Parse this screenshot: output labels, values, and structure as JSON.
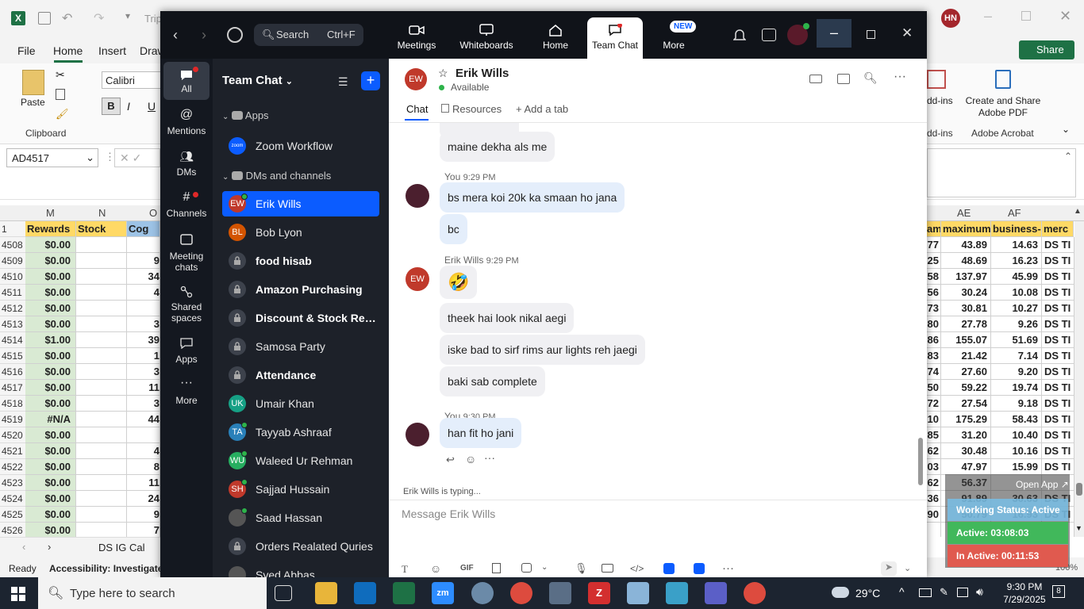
{
  "excel": {
    "title_fragment": "Trip",
    "menu": [
      "File",
      "Home",
      "Insert",
      "Draw"
    ],
    "share_label": "Share",
    "clipboard": {
      "paste_label": "Paste",
      "group_label": "Clipboard"
    },
    "font_name": "Calibri",
    "addins_label": "dd-ins",
    "addins_group": "dd-ins",
    "adobe": {
      "button": "Create and Share Adobe PDF",
      "group": "Adobe Acrobat"
    },
    "name_box": "AD4517",
    "columns_left": [
      "M",
      "N",
      "O"
    ],
    "columns_right": [
      "AE",
      "AF"
    ],
    "header_row_num": "1",
    "header_left": [
      "Rewards",
      "Stock",
      "Cog"
    ],
    "header_right": [
      "am",
      "maximum",
      "business-(",
      "merc"
    ],
    "rows": [
      {
        "n": "4508",
        "rewards": "$0.00",
        "o": "",
        "ad": "77",
        "ae": "43.89",
        "af": "14.63",
        "ag": "DS TI"
      },
      {
        "n": "4509",
        "rewards": "$0.00",
        "o": "9",
        "ad": "25",
        "ae": "48.69",
        "af": "16.23",
        "ag": "DS TI"
      },
      {
        "n": "4510",
        "rewards": "$0.00",
        "o": "34",
        "ad": "58",
        "ae": "137.97",
        "af": "45.99",
        "ag": "DS TI"
      },
      {
        "n": "4511",
        "rewards": "$0.00",
        "o": "4",
        "ad": "56",
        "ae": "30.24",
        "af": "10.08",
        "ag": "DS TI"
      },
      {
        "n": "4512",
        "rewards": "$0.00",
        "o": "",
        "ad": "73",
        "ae": "30.81",
        "af": "10.27",
        "ag": "DS TI"
      },
      {
        "n": "4513",
        "rewards": "$0.00",
        "o": "3",
        "ad": "80",
        "ae": "27.78",
        "af": "9.26",
        "ag": "DS TI"
      },
      {
        "n": "4514",
        "rewards": "$1.00",
        "o": "39",
        "ad": "86",
        "ae": "155.07",
        "af": "51.69",
        "ag": "DS TI"
      },
      {
        "n": "4515",
        "rewards": "$0.00",
        "o": "1",
        "ad": "83",
        "ae": "21.42",
        "af": "7.14",
        "ag": "DS TI"
      },
      {
        "n": "4516",
        "rewards": "$0.00",
        "o": "3",
        "ad": "74",
        "ae": "27.60",
        "af": "9.20",
        "ag": "DS TI"
      },
      {
        "n": "4517",
        "rewards": "$0.00",
        "o": "11",
        "ad": "50",
        "ae": "59.22",
        "af": "19.74",
        "ag": "DS TI"
      },
      {
        "n": "4518",
        "rewards": "$0.00",
        "o": "3",
        "ad": "72",
        "ae": "27.54",
        "af": "9.18",
        "ag": "DS TI"
      },
      {
        "n": "4519",
        "rewards": "#N/A",
        "o": "44",
        "ad": "10",
        "ae": "175.29",
        "af": "58.43",
        "ag": "DS TI"
      },
      {
        "n": "4520",
        "rewards": "$0.00",
        "o": "",
        "ad": "85",
        "ae": "31.20",
        "af": "10.40",
        "ag": "DS TI"
      },
      {
        "n": "4521",
        "rewards": "$0.00",
        "o": "4",
        "ad": "62",
        "ae": "30.48",
        "af": "10.16",
        "ag": "DS TI"
      },
      {
        "n": "4522",
        "rewards": "$0.00",
        "o": "8",
        "ad": "03",
        "ae": "47.97",
        "af": "15.99",
        "ag": "DS TI"
      },
      {
        "n": "4523",
        "rewards": "$0.00",
        "o": "11",
        "ad": "62",
        "ae": "56.37",
        "af": "",
        "ag": ""
      },
      {
        "n": "4524",
        "rewards": "$0.00",
        "o": "24",
        "ad": "36",
        "ae": "91.89",
        "af": "30.63",
        "ag": "DS TI"
      },
      {
        "n": "4525",
        "rewards": "$0.00",
        "o": "9",
        "ad": "90",
        "ae": "50.79",
        "af": "16.93",
        "ag": "DS TI"
      },
      {
        "n": "4526",
        "rewards": "$0.00",
        "o": "7",
        "ad": "",
        "ae": "",
        "af": "",
        "ag": ""
      }
    ],
    "sheet_tab": "DS IG Cal",
    "status_ready": "Ready",
    "status_accessibility": "Accessibility: Investigate",
    "zoom_pct": "100%"
  },
  "zoom": {
    "search_label": "Search",
    "search_shortcut": "Ctrl+F",
    "nav": [
      {
        "label": "Meetings"
      },
      {
        "label": "Whiteboards"
      },
      {
        "label": "Home"
      },
      {
        "label": "Team Chat"
      },
      {
        "label": "More"
      }
    ],
    "new_badge": "NEW",
    "rail": [
      "All",
      "Mentions",
      "DMs",
      "Channels",
      "Meeting chats",
      "Shared spaces",
      "Apps",
      "More"
    ],
    "list_title": "Team Chat",
    "sections": {
      "apps": "Apps",
      "dms": "DMs and channels"
    },
    "app_item": {
      "name": "Zoom Workflow",
      "icon_text": "zoom"
    },
    "channels": [
      {
        "name": "Erik Wills",
        "initials": "EW",
        "color": "#c0392b",
        "bold": false,
        "selected": true,
        "online": true,
        "type": "dm"
      },
      {
        "name": "Bob Lyon",
        "initials": "BL",
        "color": "#d35400",
        "bold": false,
        "selected": false,
        "online": false,
        "type": "dm"
      },
      {
        "name": "food hisab",
        "initials": "",
        "color": "",
        "bold": true,
        "selected": false,
        "online": false,
        "type": "lock"
      },
      {
        "name": "Amazon Purchasing",
        "initials": "",
        "color": "",
        "bold": true,
        "selected": false,
        "online": false,
        "type": "lock"
      },
      {
        "name": "Discount & Stock Res...",
        "initials": "",
        "color": "",
        "bold": true,
        "selected": false,
        "online": false,
        "type": "lock"
      },
      {
        "name": "Samosa Party",
        "initials": "",
        "color": "",
        "bold": false,
        "selected": false,
        "online": false,
        "type": "lock"
      },
      {
        "name": "Attendance",
        "initials": "",
        "color": "",
        "bold": true,
        "selected": false,
        "online": false,
        "type": "lock"
      },
      {
        "name": "Umair Khan",
        "initials": "UK",
        "color": "#16a085",
        "bold": false,
        "selected": false,
        "online": false,
        "type": "dm"
      },
      {
        "name": "Tayyab Ashraaf",
        "initials": "TA",
        "color": "#2980b9",
        "bold": false,
        "selected": false,
        "online": true,
        "type": "dm"
      },
      {
        "name": "Waleed Ur Rehman",
        "initials": "WU",
        "color": "#27ae60",
        "bold": false,
        "selected": false,
        "online": true,
        "type": "dm"
      },
      {
        "name": "Sajjad Hussain",
        "initials": "SH",
        "color": "#c0392b",
        "bold": false,
        "selected": false,
        "online": true,
        "type": "dm"
      },
      {
        "name": "Saad Hassan",
        "initials": "",
        "color": "#555",
        "bold": false,
        "selected": false,
        "online": true,
        "type": "photo"
      },
      {
        "name": "Orders Realated Quries",
        "initials": "",
        "color": "",
        "bold": false,
        "selected": false,
        "online": false,
        "type": "lock"
      },
      {
        "name": "Syed Abbas",
        "initials": "",
        "color": "#555",
        "bold": false,
        "selected": false,
        "online": false,
        "type": "photo"
      }
    ],
    "chat": {
      "contact_initials": "EW",
      "contact_name": "Erik Wills",
      "contact_status": "Available",
      "tabs": [
        "Chat",
        "Resources",
        "Add a tab"
      ],
      "messages": [
        {
          "text": "maine dekha als me",
          "mine": false
        },
        {
          "sender": "You",
          "time": "9:29 PM"
        },
        {
          "text": "bs mera koi 20k ka smaan ho jana",
          "mine": true
        },
        {
          "text": "bc",
          "mine": true
        },
        {
          "sender": "Erik Wills",
          "time": "9:29 PM"
        },
        {
          "text": "🤣",
          "mine": false
        },
        {
          "text": "theek hai look nikal aegi",
          "mine": false
        },
        {
          "text": "iske bad to sirf rims aur lights reh jaegi",
          "mine": false
        },
        {
          "text": "baki sab complete",
          "mine": false
        },
        {
          "sender": "You",
          "time": "9:30 PM"
        },
        {
          "text": "han fit ho jani",
          "mine": true
        }
      ],
      "typing_name": "Erik Wills",
      "typing_suffix": "is typing...",
      "composer_placeholder": "Message Erik Wills"
    }
  },
  "overlay": {
    "open_app": "Open App ↗",
    "working_status": "Working Status: Active",
    "active": "Active: 03:08:03",
    "inactive": "In Active: 00:11:53"
  },
  "taskbar": {
    "search_placeholder": "Type here to search",
    "weather": "29°C",
    "time": "9:30 PM",
    "date": "7/29/2025",
    "notifications": "8",
    "excel_avatar": "HN"
  },
  "colors": {
    "zoom_blue": "#0b5cff",
    "excel_green": "#1e7145",
    "rewards_fill": "#d9ead3",
    "header_fill": "#ffd966"
  }
}
